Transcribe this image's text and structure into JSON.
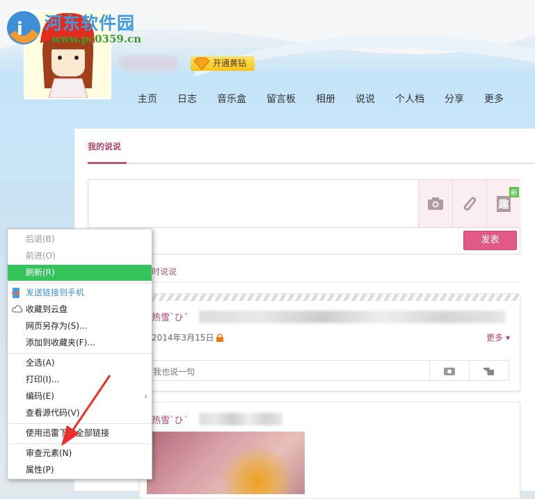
{
  "watermark": {
    "name": "河东软件园",
    "url": "www.pc0359.cn"
  },
  "header": {
    "vip_label": "开通黄钻"
  },
  "nav": [
    "主页",
    "日志",
    "音乐盒",
    "留言板",
    "相册",
    "说说",
    "个人档",
    "分享",
    "更多"
  ],
  "main": {
    "tab": "我的说说",
    "editor": {
      "new_badge": "新",
      "fun_icon_text": "趣",
      "send_label": "发表"
    },
    "subtab": "时说说",
    "posts": [
      {
        "user": "热雪`ひ´",
        "date": "2014年3月15日",
        "more_label": "更多",
        "comment_placeholder": "我也说一句"
      },
      {
        "user": "热雪`ひ´"
      }
    ]
  },
  "context_menu": {
    "items": [
      {
        "label": "后退(B)",
        "disabled": true
      },
      {
        "label": "前进(O)",
        "disabled": true
      },
      {
        "label": "刷新(R)",
        "highlighted": true
      },
      {
        "label": "发送链接到手机",
        "icon": "phone-send-icon"
      },
      {
        "label": "收藏到云盘",
        "icon": "cloud-icon"
      },
      {
        "label": "网页另存为(S)..."
      },
      {
        "label": "添加到收藏夹(F)..."
      },
      {
        "label": "全选(A)"
      },
      {
        "label": "打印(I)..."
      },
      {
        "label": "编码(E)",
        "submenu": true
      },
      {
        "label": "查看源代码(V)"
      },
      {
        "label": "使用迅雷下载全部链接"
      },
      {
        "label": "审查元素(N)"
      },
      {
        "label": "属性(P)"
      }
    ]
  },
  "colors": {
    "accent": "#b0476a",
    "send": "#e05a85",
    "highlight": "#35c45c",
    "arrow": "#e8302a"
  }
}
